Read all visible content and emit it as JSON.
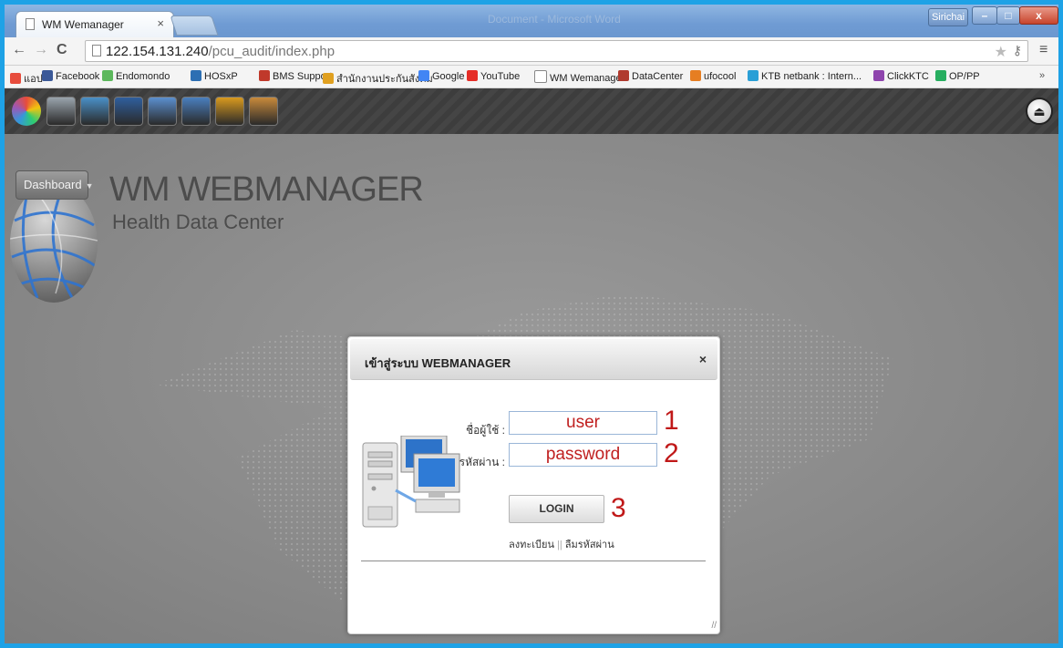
{
  "browser": {
    "tab_title": "WM Wemanager",
    "tab_close": "×",
    "window_title": "Document - Microsoft Word",
    "user_badge": "Sirichai",
    "url_host": "122.154.131.240",
    "url_path": "/pcu_audit/index.php",
    "bookmarks": [
      {
        "label": "แอป",
        "color": "#e74c3c"
      },
      {
        "label": "Facebook",
        "color": "#3b5998"
      },
      {
        "label": "Endomondo",
        "color": "#5cb85c"
      },
      {
        "label": "HOSxP",
        "color": "#2d6fb3"
      },
      {
        "label": "BMS Support",
        "color": "#c0392b"
      },
      {
        "label": "สำนักงานประกันสังคม",
        "color": "#e0a020"
      },
      {
        "label": "Google",
        "color": "#4285f4"
      },
      {
        "label": "YouTube",
        "color": "#e52d27"
      },
      {
        "label": "WM Wemanager",
        "color": "#ffffff"
      },
      {
        "label": "DataCenter",
        "color": "#b03a2e"
      },
      {
        "label": "ufocool",
        "color": "#e67e22"
      },
      {
        "label": "KTB netbank : Intern...",
        "color": "#2a9fd6"
      },
      {
        "label": "ClickKTC",
        "color": "#8e44ad"
      },
      {
        "label": "OP/PP",
        "color": "#27ae60"
      }
    ],
    "bookmarks_more": "»"
  },
  "toolbar": {
    "icons": [
      {
        "name": "color-wheel-icon",
        "color": "#e8a030"
      },
      {
        "name": "home-icon",
        "color": "#9aa4ad"
      },
      {
        "name": "globe-icon",
        "color": "#4a90c8"
      },
      {
        "name": "hdc-logo-icon",
        "color": "#2f5f9e"
      },
      {
        "name": "network-icon",
        "color": "#5b8fcf"
      },
      {
        "name": "heartbeat-icon",
        "color": "#4a7fbf"
      },
      {
        "name": "people-icon",
        "color": "#d99a1e"
      },
      {
        "name": "user-icon",
        "color": "#c98a3b"
      }
    ]
  },
  "app": {
    "dashboard_label": "Dashboard",
    "title": "WM WEBMANAGER",
    "subtitle": "Health Data Center"
  },
  "login": {
    "title": "เข้าสู่ระบบ WEBMANAGER",
    "close": "×",
    "username_label": "ชื่อผู้ใช้ :",
    "username_value": "user",
    "password_label": "รหัสผ่าน :",
    "password_value": "password",
    "login_button": "LOGIN",
    "register_link": "ลงทะเบียน",
    "separator": "||",
    "forgot_link": "ลืมรหัสผ่าน",
    "step_1": "1",
    "step_2": "2",
    "step_3": "3"
  }
}
